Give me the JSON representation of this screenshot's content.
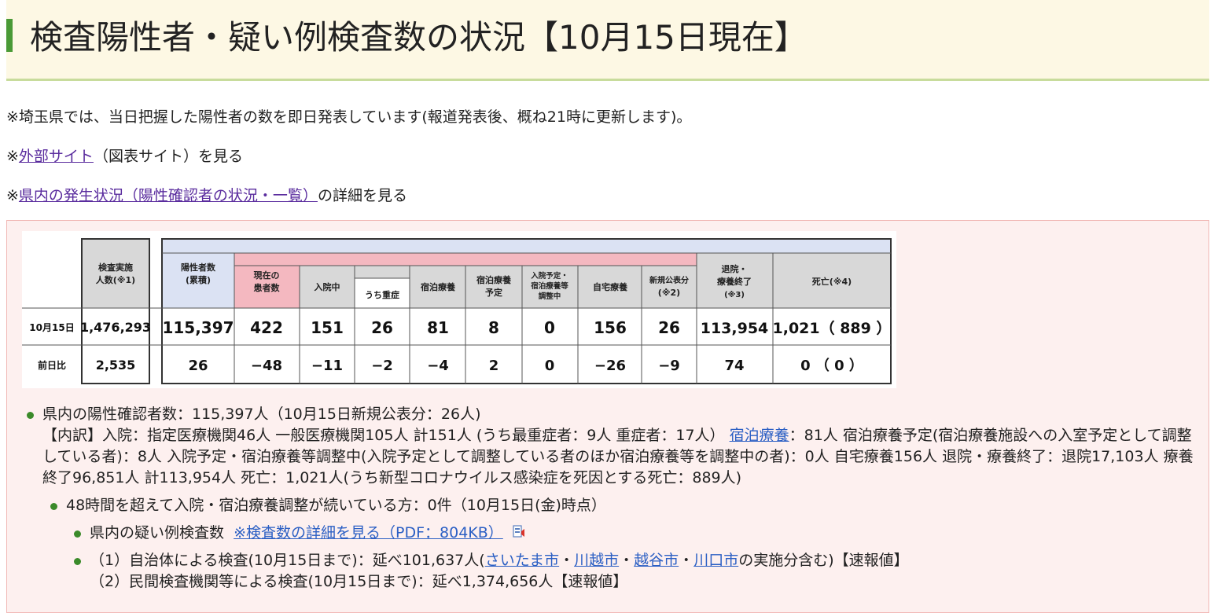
{
  "header": {
    "title": "検査陽性者・疑い例検査数の状況【10月15日現在】"
  },
  "notes": {
    "note1": "※埼玉県では、当日把握した陽性者の数を即日発表しています(報道発表後、概ね21時に更新します)。",
    "note2_prefix": "※",
    "note2_link": "外部サイト",
    "note2_suffix": "（図表サイト）を見る",
    "note3_prefix": "※",
    "note3_link": "県内の発生状況（陽性確認者の状況・一覧）",
    "note3_suffix": "の詳細を見る"
  },
  "table": {
    "headers": {
      "tests": "検査実施",
      "tests2": "人数(※1)",
      "positives": "陽性者数",
      "positives2": "(累積)",
      "current": "現在の",
      "current2": "患者数",
      "hospitalized": "入院中",
      "severe": "うち重症",
      "hotel": "宿泊療養",
      "hotel_planned": "宿泊療養",
      "hotel_planned2": "予定",
      "adjusting": "入院予定・",
      "adjusting2": "宿泊療養等",
      "adjusting3": "調整中",
      "home": "自宅療養",
      "new": "新規公表分",
      "new2": "(※2)",
      "discharged": "退院・",
      "discharged2": "療養終了",
      "discharged3": "(※3)",
      "deaths": "死亡(※4)"
    },
    "row_today": {
      "label": "10月15日",
      "tests": "1,476,293",
      "positives": "115,397",
      "current": "422",
      "hospitalized": "151",
      "severe": "26",
      "hotel": "81",
      "hotel_planned": "8",
      "adjusting": "0",
      "home": "156",
      "new": "26",
      "discharged": "113,954",
      "deaths": "1,021（ 889 ）"
    },
    "row_diff": {
      "label": "前日比",
      "tests": "2,535",
      "positives": "26",
      "current": "−48",
      "hospitalized": "−11",
      "severe": "−2",
      "hotel": "−4",
      "hotel_planned": "2",
      "adjusting": "0",
      "home": "−26",
      "new": "−9",
      "discharged": "74",
      "deaths": "0 （ 0 ）"
    }
  },
  "summary": {
    "line1": "県内の陽性確認者数：115,397人（10月15日新規公表分：26人)",
    "breakdown_a": "【内訳】入院：指定医療機関46人 一般医療機関105人 計151人 (うち最重症者：9人 重症者：17人） ",
    "breakdown_link": "宿泊療養",
    "breakdown_b": "：81人 宿泊療養予定(宿泊療養施設への入室予定として調整している者)：8人 入院予定・宿泊療養等調整中(入院予定として調整している者のほか宿泊療養等を調整中の者)：0人 自宅療養156人 退院・療養終了：退院17,103人 療養終了96,851人 計113,954人 死亡：1,021人(うち新型コロナウイルス感染症を死因とする死亡：889人)",
    "line48h": "48時間を超えて入院・宿泊療養調整が続いている方：0件（10月15日(金)時点）",
    "suspected_label": "県内の疑い例検査数",
    "suspected_link": "※検査数の詳細を見る（PDF：804KB）",
    "local1_prefix": "（1）自治体による検査(10月15日まで)：延べ101,637人(",
    "city1": "さいたま市",
    "sep": "・",
    "city2": "川越市",
    "city3": "越谷市",
    "city4": "川口市",
    "local1_suffix": "の実施分含む)【速報値】",
    "local2": "（2）民間検査機関等による検査(10月15日まで)：延べ1,374,656人【速報値】"
  },
  "colors": {
    "accent": "#4a9a36",
    "link": "#5a2c9e",
    "pink": "#f4b8c0",
    "blue": "#dbe2f3"
  }
}
